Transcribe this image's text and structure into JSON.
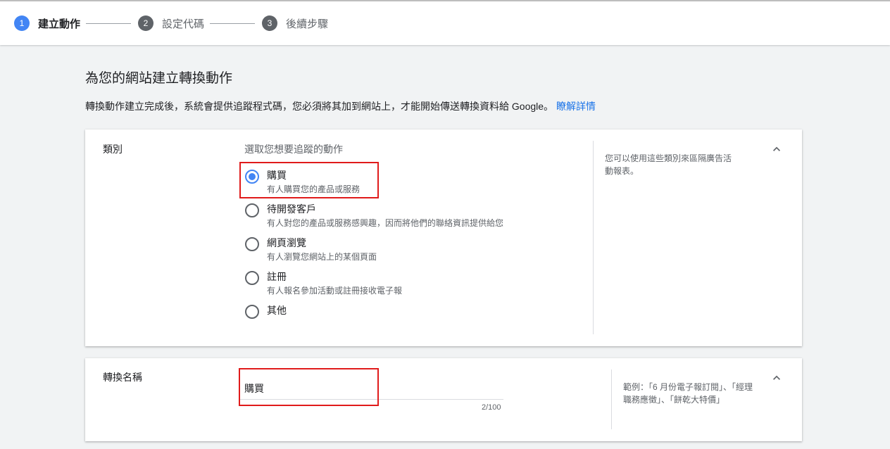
{
  "stepper": {
    "steps": [
      {
        "number": "1",
        "label": "建立動作"
      },
      {
        "number": "2",
        "label": "設定代碼"
      },
      {
        "number": "3",
        "label": "後續步驟"
      }
    ]
  },
  "page": {
    "title": "為您的網站建立轉換動作",
    "description": "轉換動作建立完成後，系統會提供追蹤程式碼，您必須將其加到網站上，才能開始傳送轉換資料給 Google。",
    "learn_more": "瞭解詳情"
  },
  "category": {
    "label": "類別",
    "hint": "選取您想要追蹤的動作",
    "options": [
      {
        "title": "購買",
        "desc": "有人購買您的產品或服務",
        "selected": true
      },
      {
        "title": "待開發客戶",
        "desc": "有人對您的產品或服務感興趣，因而將他們的聯絡資訊提供給您",
        "selected": false
      },
      {
        "title": "網頁瀏覽",
        "desc": "有人瀏覽您網站上的某個頁面",
        "selected": false
      },
      {
        "title": "註冊",
        "desc": "有人報名參加活動或註冊接收電子報",
        "selected": false
      },
      {
        "title": "其他",
        "desc": "",
        "selected": false
      }
    ],
    "help": "您可以使用這些類別來區隔廣告活動報表。"
  },
  "conversion_name": {
    "label": "轉換名稱",
    "value": "購買",
    "counter": "2/100",
    "help": "範例：「6 月份電子報訂閱」、「經理職務應徵」、「餅乾大特價」"
  },
  "colors": {
    "accent": "#4285f4",
    "link": "#1a73e8",
    "highlight": "#e01b1b"
  }
}
